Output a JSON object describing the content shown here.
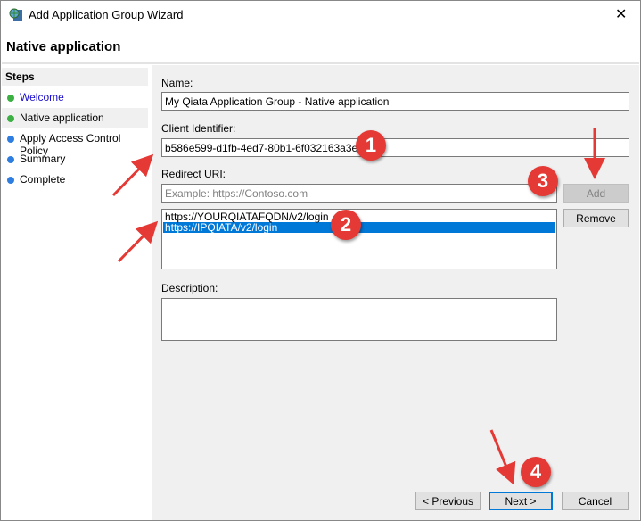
{
  "window": {
    "title": "Add Application Group Wizard",
    "page_heading": "Native application",
    "close_icon": "close-icon",
    "app_icon": "server-globe-icon"
  },
  "steps": {
    "heading": "Steps",
    "items": [
      {
        "label": "Welcome",
        "status": "done",
        "color": "#3cb043"
      },
      {
        "label": "Native application",
        "status": "current",
        "color": "#3cb043"
      },
      {
        "label": "Apply Access Control Policy",
        "status": "pending",
        "color": "#2e7de0"
      },
      {
        "label": "Summary",
        "status": "pending",
        "color": "#2e7de0"
      },
      {
        "label": "Complete",
        "status": "pending",
        "color": "#2e7de0"
      }
    ]
  },
  "form": {
    "name_label": "Name:",
    "name_value": "My Qiata Application Group - Native application",
    "client_id_label": "Client Identifier:",
    "client_id_value": "b586e599-d1fb-4ed7-80b1-6f032163a3e4",
    "redirect_label": "Redirect URI:",
    "redirect_placeholder": "Example: https://Contoso.com",
    "add_label": "Add",
    "remove_label": "Remove",
    "redirect_list": [
      {
        "value": "https://YOURQIATAFQDN/v2/login",
        "selected": false
      },
      {
        "value": "https://IPQIATA/v2/login",
        "selected": true
      }
    ],
    "description_label": "Description:",
    "description_value": ""
  },
  "footer": {
    "previous_label": "< Previous",
    "next_label": "Next >",
    "cancel_label": "Cancel"
  },
  "annotations": {
    "badges": [
      "1",
      "2",
      "3",
      "4"
    ],
    "color": "#e53935"
  }
}
